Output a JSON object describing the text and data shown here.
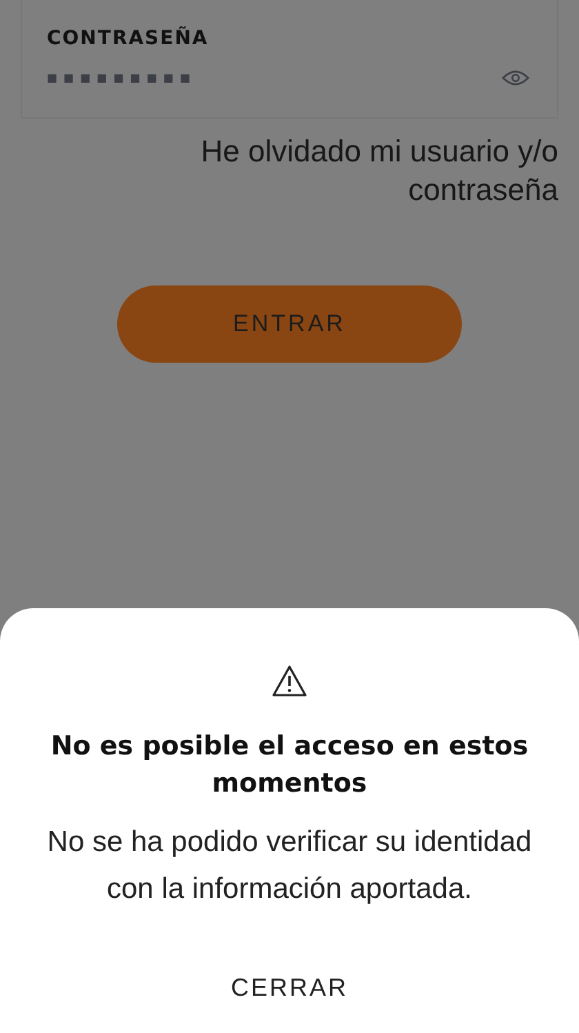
{
  "password_field": {
    "label": "CONTRASEÑA",
    "value": "■■■■■■■■■",
    "masked": true
  },
  "forgot_link": "He olvidado mi usuario y/o contraseña",
  "login_button": "ENTRAR",
  "dialog": {
    "title": "No es posible el acceso en estos momentos",
    "message": "No se ha podido verificar su identidad con la información aportada.",
    "button": "CERRAR"
  }
}
